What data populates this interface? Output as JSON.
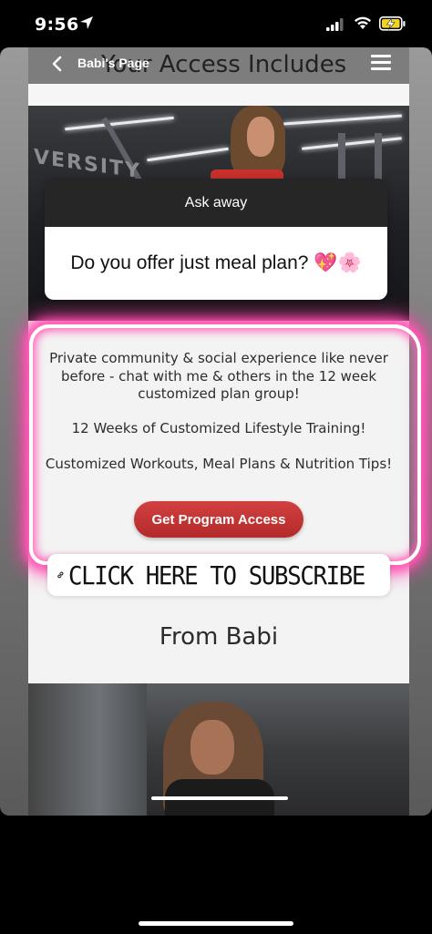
{
  "status_bar": {
    "time": "9:56"
  },
  "top_bar": {
    "page_title": "Babi's Page",
    "section_heading": "Your Access Includes"
  },
  "photo1": {
    "sign_text": "VERSITY"
  },
  "question_sticker": {
    "header": "Ask away",
    "question": "Do you offer just meal plan? 💖🌸"
  },
  "features": [
    "Private community & social experience like never before - chat with me & others in the 12 week customized plan group!",
    "12 Weeks of Customized Lifestyle Training!",
    "Customized Workouts, Meal Plans & Nutrition Tips!"
  ],
  "cta": {
    "label": "Get Program Access"
  },
  "link_sticker": {
    "text": "CLICK HERE TO SUBSCRIBE"
  },
  "from_section": {
    "label": "From Babi"
  },
  "colors": {
    "neon": "#ff3fa8",
    "cta": "#c23535",
    "sticker_header": "#262626"
  }
}
